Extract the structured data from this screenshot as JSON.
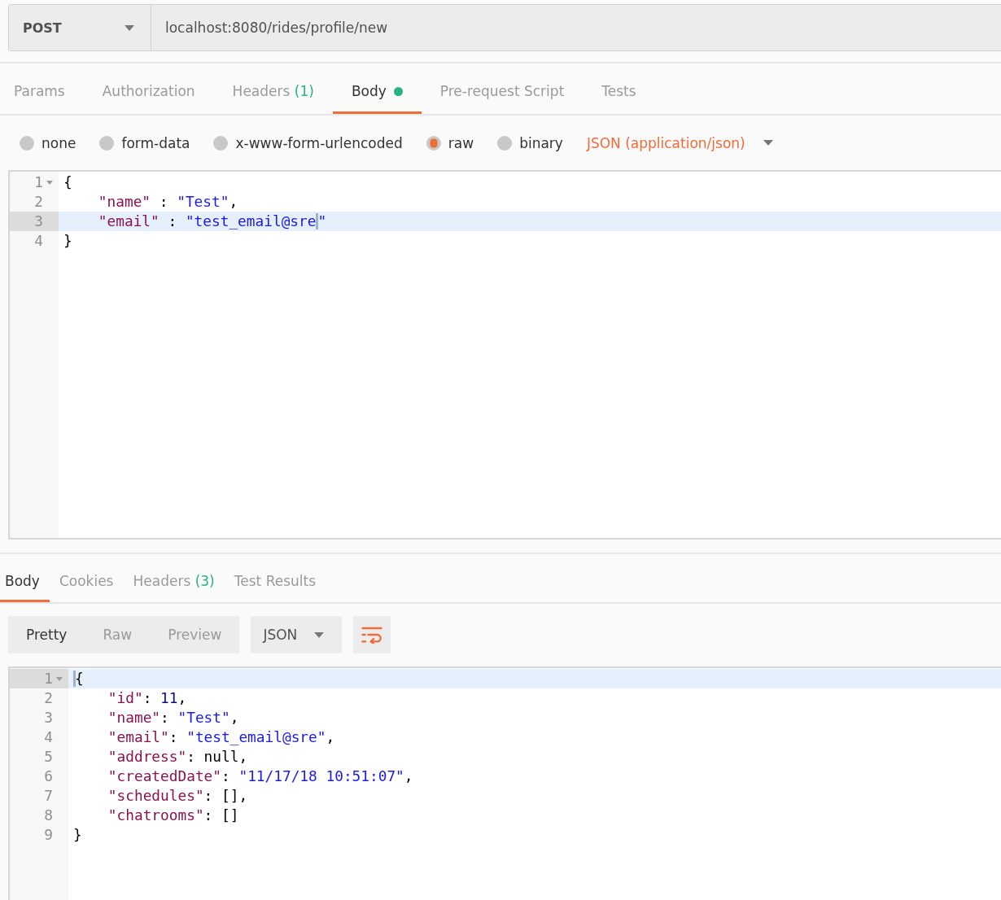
{
  "request": {
    "method": "POST",
    "url": "localhost:8080/rides/profile/new"
  },
  "request_tabs": [
    {
      "label": "Params",
      "selected": false,
      "has_content": false
    },
    {
      "label": "Authorization",
      "selected": false,
      "has_content": false
    },
    {
      "label": "Headers",
      "count": "(1)",
      "selected": false,
      "has_content": false
    },
    {
      "label": "Body",
      "selected": true,
      "has_content": true
    },
    {
      "label": "Pre-request Script",
      "selected": false,
      "has_content": false
    },
    {
      "label": "Tests",
      "selected": false,
      "has_content": false
    }
  ],
  "body_types": [
    {
      "label": "none",
      "selected": false
    },
    {
      "label": "form-data",
      "selected": false
    },
    {
      "label": "x-www-form-urlencoded",
      "selected": false
    },
    {
      "label": "raw",
      "selected": true
    },
    {
      "label": "binary",
      "selected": false
    }
  ],
  "content_type": "JSON (application/json)",
  "request_body": {
    "lines": [
      {
        "number": "1",
        "foldable": true,
        "active": false,
        "tokens": [
          {
            "kind": "punct",
            "text": "{"
          }
        ]
      },
      {
        "number": "2",
        "foldable": false,
        "active": false,
        "tokens": [
          {
            "kind": "key",
            "text": "    \"name\""
          },
          {
            "kind": "punct",
            "text": " : "
          },
          {
            "kind": "string",
            "text": "\"Test\""
          },
          {
            "kind": "punct",
            "text": ","
          }
        ]
      },
      {
        "number": "3",
        "foldable": false,
        "active": true,
        "tokens": [
          {
            "kind": "key",
            "text": "    \"email\""
          },
          {
            "kind": "punct",
            "text": " : "
          },
          {
            "kind": "string",
            "text": "\"test_email@sre"
          },
          {
            "kind": "cursor"
          },
          {
            "kind": "string",
            "text": "\""
          }
        ]
      },
      {
        "number": "4",
        "foldable": false,
        "active": false,
        "tokens": [
          {
            "kind": "punct",
            "text": "}"
          }
        ]
      }
    ]
  },
  "response_tabs": [
    {
      "label": "Body",
      "selected": true
    },
    {
      "label": "Cookies",
      "selected": false
    },
    {
      "label": "Headers",
      "count": "(3)",
      "selected": false
    },
    {
      "label": "Test Results",
      "selected": false
    }
  ],
  "view_modes": [
    {
      "label": "Pretty",
      "selected": true
    },
    {
      "label": "Raw",
      "selected": false
    },
    {
      "label": "Preview",
      "selected": false
    }
  ],
  "response_format": "JSON",
  "wrap_lines": {
    "on": true
  },
  "response_body": {
    "lines": [
      {
        "number": "1",
        "foldable": true,
        "active": true,
        "tokens": [
          {
            "kind": "cursor"
          },
          {
            "kind": "punct",
            "text": "{"
          }
        ]
      },
      {
        "number": "2",
        "foldable": false,
        "active": false,
        "tokens": [
          {
            "kind": "key",
            "text": "    \"id\""
          },
          {
            "kind": "punct",
            "text": ": "
          },
          {
            "kind": "number",
            "text": "11"
          },
          {
            "kind": "punct",
            "text": ","
          }
        ]
      },
      {
        "number": "3",
        "foldable": false,
        "active": false,
        "tokens": [
          {
            "kind": "key",
            "text": "    \"name\""
          },
          {
            "kind": "punct",
            "text": ": "
          },
          {
            "kind": "string",
            "text": "\"Test\""
          },
          {
            "kind": "punct",
            "text": ","
          }
        ]
      },
      {
        "number": "4",
        "foldable": false,
        "active": false,
        "tokens": [
          {
            "kind": "key",
            "text": "    \"email\""
          },
          {
            "kind": "punct",
            "text": ": "
          },
          {
            "kind": "string",
            "text": "\"test_email@sre\""
          },
          {
            "kind": "punct",
            "text": ","
          }
        ]
      },
      {
        "number": "5",
        "foldable": false,
        "active": false,
        "tokens": [
          {
            "kind": "key",
            "text": "    \"address\""
          },
          {
            "kind": "punct",
            "text": ": "
          },
          {
            "kind": "constant",
            "text": "null"
          },
          {
            "kind": "punct",
            "text": ","
          }
        ]
      },
      {
        "number": "6",
        "foldable": false,
        "active": false,
        "tokens": [
          {
            "kind": "key",
            "text": "    \"createdDate\""
          },
          {
            "kind": "punct",
            "text": ": "
          },
          {
            "kind": "string",
            "text": "\"11/17/18 10:51:07\""
          },
          {
            "kind": "punct",
            "text": ","
          }
        ]
      },
      {
        "number": "7",
        "foldable": false,
        "active": false,
        "tokens": [
          {
            "kind": "key",
            "text": "    \"schedules\""
          },
          {
            "kind": "punct",
            "text": ": "
          },
          {
            "kind": "punct",
            "text": "[],"
          }
        ]
      },
      {
        "number": "8",
        "foldable": false,
        "active": false,
        "tokens": [
          {
            "kind": "key",
            "text": "    \"chatrooms\""
          },
          {
            "kind": "punct",
            "text": ": "
          },
          {
            "kind": "punct",
            "text": "[]"
          }
        ]
      },
      {
        "number": "9",
        "foldable": false,
        "active": false,
        "tokens": [
          {
            "kind": "punct",
            "text": "}"
          }
        ]
      }
    ]
  }
}
